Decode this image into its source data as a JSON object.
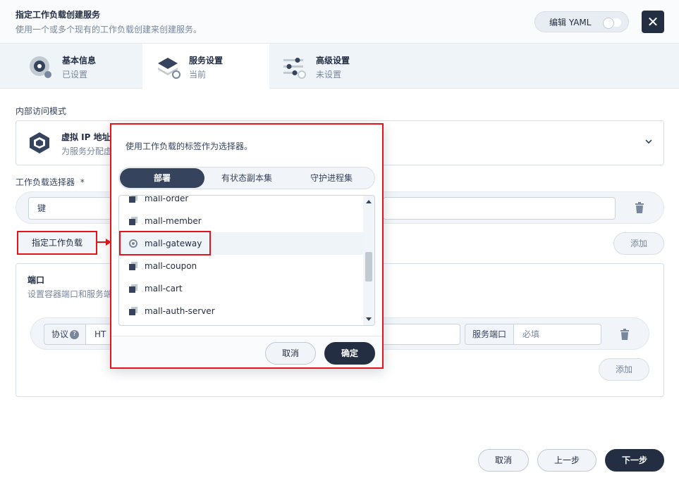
{
  "header": {
    "title": "指定工作负载创建服务",
    "subtitle": "使用一个或多个现有的工作负载创建来创建服务。",
    "yaml_label": "编辑 YAML",
    "close_icon": "close-icon"
  },
  "steps": [
    {
      "title": "基本信息",
      "status": "已设置",
      "icon": "info-icon"
    },
    {
      "title": "服务设置",
      "status": "当前",
      "icon": "layers-icon"
    },
    {
      "title": "高级设置",
      "status": "未设置",
      "icon": "sliders-icon"
    }
  ],
  "access_mode": {
    "label": "内部访问模式",
    "title": "虚拟 IP 地址",
    "description": "为服务分配虚"
  },
  "selector": {
    "label": "工作负载选择器",
    "required_mark": "*",
    "key_placeholder": "键",
    "assign_label": "指定工作负载",
    "add_label": "添加"
  },
  "ports": {
    "title": "端口",
    "description": "设置容器端口和服务端",
    "protocol_label": "协议",
    "protocol_value": "HT",
    "service_port_label": "服务端口",
    "service_port_placeholder": "必填",
    "add_label": "添加"
  },
  "popup": {
    "hint": "使用工作负载的标签作为选择器。",
    "tabs": [
      "部署",
      "有状态副本集",
      "守护进程集"
    ],
    "active_tab": 0,
    "items": [
      {
        "name": "mall-order",
        "selected": false
      },
      {
        "name": "mall-member",
        "selected": false
      },
      {
        "name": "mall-gateway",
        "selected": true
      },
      {
        "name": "mall-coupon",
        "selected": false
      },
      {
        "name": "mall-cart",
        "selected": false
      },
      {
        "name": "mall-auth-server",
        "selected": false
      }
    ],
    "cancel_label": "取消",
    "confirm_label": "确定"
  },
  "footer": {
    "cancel_label": "取消",
    "prev_label": "上一步",
    "next_label": "下一步"
  },
  "colors": {
    "primary_dark": "#242e42",
    "annotation_red": "#e5141b",
    "muted_text": "#79879c"
  }
}
